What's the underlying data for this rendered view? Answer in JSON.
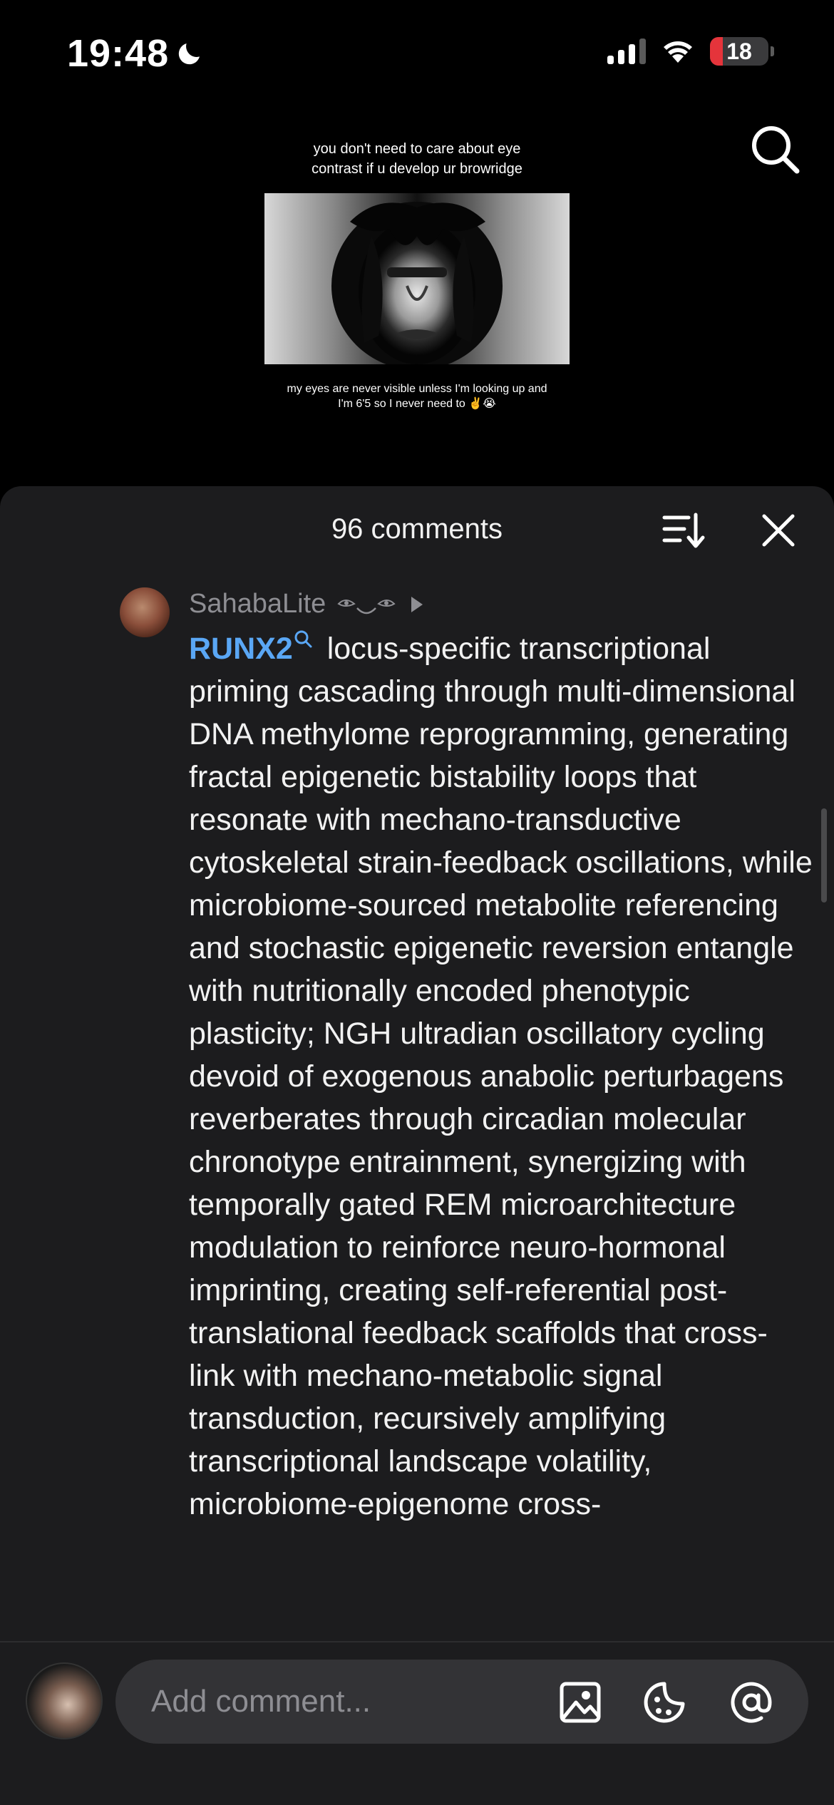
{
  "status": {
    "time": "19:48",
    "battery": "18",
    "icons": [
      "moon-icon",
      "cellular-signal-icon",
      "wifi-icon",
      "battery-icon"
    ]
  },
  "video": {
    "caption_top": "you don't need to care about eye contrast if u develop ur browridge",
    "caption_bottom": "my eyes are never visible unless I'm looking up and I'm 6'5 so I never need to ✌️😭"
  },
  "comments_sheet": {
    "count_label": "96 comments"
  },
  "comment": {
    "username": "SahabaLite",
    "tag": "RUNX2",
    "text": "locus-specific transcriptional priming cascading through multi-dimensional DNA methylome reprogramming, generating fractal epigenetic bistability loops that resonate with mechano-transductive cytoskeletal strain-feedback oscillations, while microbiome-sourced metabolite referencing and stochastic epigenetic reversion entangle with nutritionally encoded phenotypic plasticity; NGH ultradian oscillatory cycling devoid of exogenous anabolic perturbagens reverberates through circadian molecular chronotype entrainment, synergizing with temporally gated REM microarchitecture modulation to reinforce neuro-hormonal imprinting, creating self-referential post-translational feedback scaffolds that cross-link with mechano-metabolic signal transduction, recursively amplifying transcriptional landscape volatility, microbiome-epigenome cross-"
  },
  "composer": {
    "placeholder": "Add comment..."
  },
  "colors": {
    "sheet_bg": "#1c1c1e",
    "tag_blue": "#5aa7f5",
    "muted": "#8e8e93",
    "battery_red": "#e5343b"
  }
}
